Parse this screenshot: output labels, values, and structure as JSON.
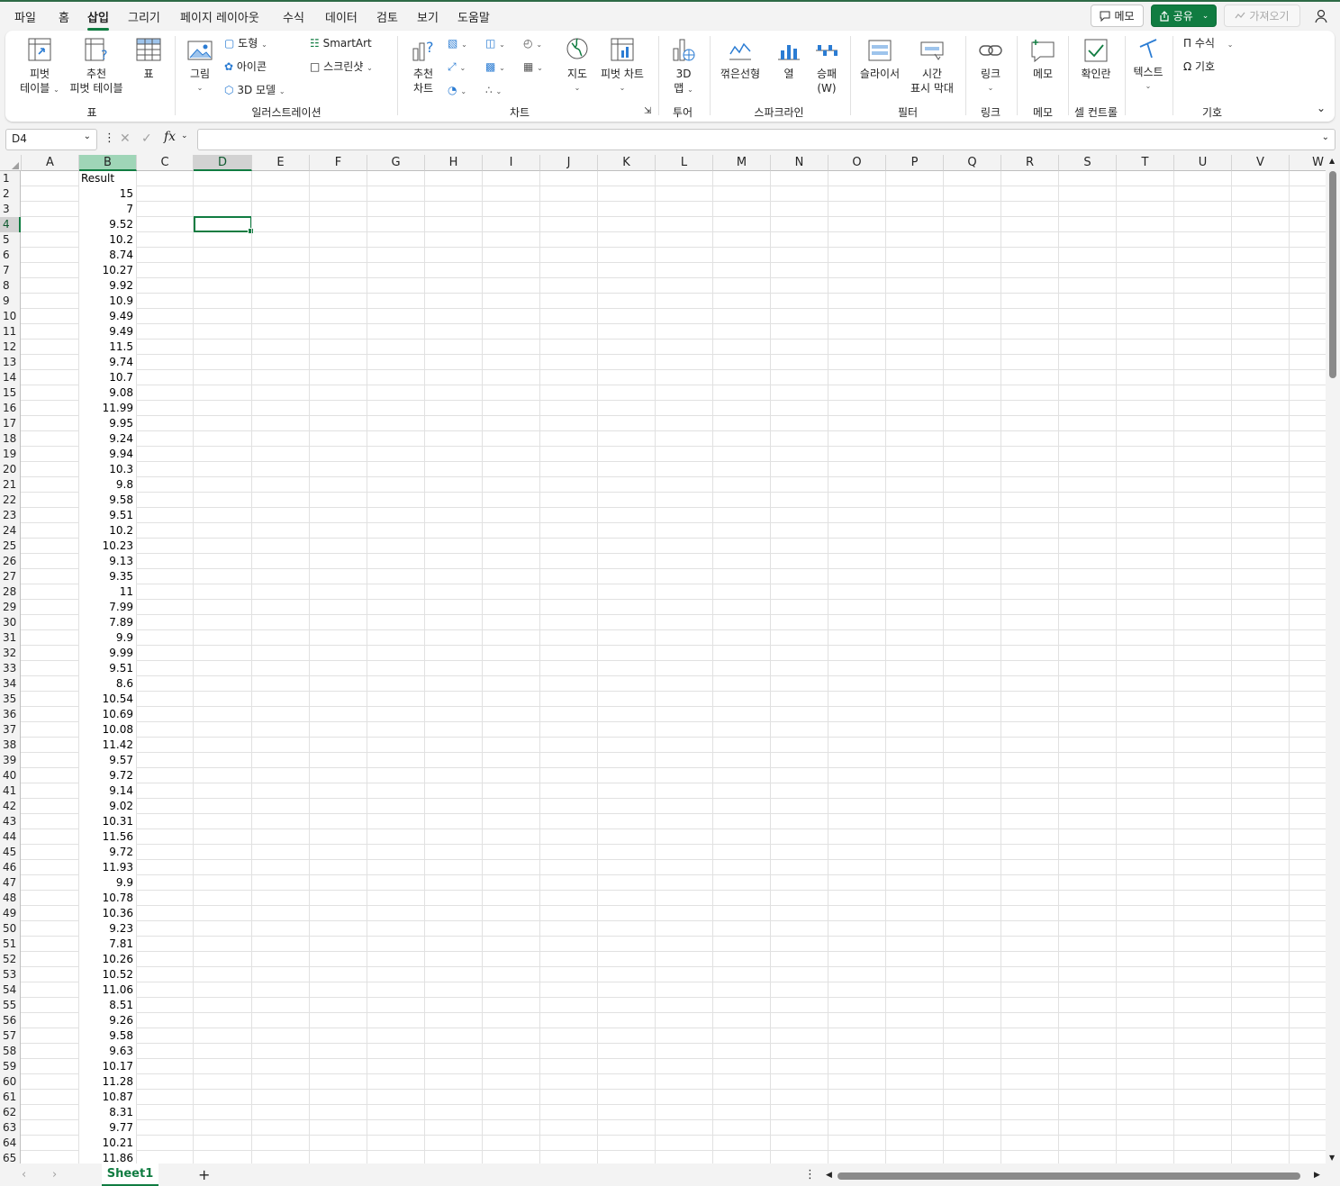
{
  "tabs": [
    "파일",
    "홈",
    "삽입",
    "그리기",
    "페이지 레이아웃",
    "수식",
    "데이터",
    "검토",
    "보기",
    "도움말"
  ],
  "active_tab": "삽입",
  "top_buttons": {
    "memo": "메모",
    "share": "공유",
    "fetch": "가져오기"
  },
  "ribbon": {
    "pivot_table": [
      "피벗",
      "테이블"
    ],
    "recommended_pivot": [
      "추천",
      "피벗 테이블"
    ],
    "table": "표",
    "picture": "그림",
    "shapes": "도형",
    "icons": "아이콘",
    "models3d": "3D 모델",
    "smartart": "SmartArt",
    "screenshot": "스크린샷",
    "recommended_charts": [
      "추천",
      "차트"
    ],
    "map": "지도",
    "pivot_chart": "피벗 차트",
    "map3d": [
      "3D",
      "맵"
    ],
    "spark_line": "꺾은선형",
    "spark_column": "열",
    "spark_winloss": [
      "승패",
      "(W)"
    ],
    "slicer": "슬라이서",
    "timeline": [
      "시간",
      "표시 막대"
    ],
    "link": "링크",
    "comment": "메모",
    "checkbox": "확인란",
    "text": "텍스트",
    "equation": "수식",
    "symbol": "기호",
    "groups": {
      "tables": "표",
      "illustrations": "일러스트레이션",
      "charts": "차트",
      "tours": "투어",
      "sparklines": "스파크라인",
      "filters": "필터",
      "links": "링크",
      "comments": "메모",
      "cell_controls": "셀 컨트롤",
      "symbols": "기호"
    }
  },
  "name_box": "D4",
  "formula_value": "",
  "columns": [
    "A",
    "B",
    "C",
    "D",
    "E",
    "F",
    "G",
    "H",
    "I",
    "J",
    "K",
    "L",
    "M",
    "N",
    "O",
    "P",
    "Q",
    "R",
    "S",
    "T",
    "U",
    "V",
    "W"
  ],
  "selected_column": "D",
  "highlighted_column": "B",
  "rows": [
    "1",
    "2",
    "3",
    "4",
    "5",
    "6",
    "7",
    "8",
    "9",
    "10",
    "11",
    "12",
    "13",
    "14",
    "15",
    "16",
    "17",
    "18",
    "19",
    "20",
    "21",
    "22",
    "23",
    "24",
    "25",
    "26",
    "27",
    "28",
    "29",
    "30",
    "31",
    "32",
    "33",
    "34",
    "35",
    "36",
    "37",
    "38",
    "39",
    "40",
    "41",
    "42",
    "43",
    "44",
    "45",
    "46",
    "47",
    "48",
    "49",
    "50",
    "51",
    "52",
    "53",
    "54",
    "55",
    "56",
    "57",
    "58",
    "59",
    "60",
    "61",
    "62",
    "63",
    "64",
    "65"
  ],
  "selected_row": "4",
  "column_b": [
    "Result",
    "15",
    "7",
    "9.52",
    "10.2",
    "8.74",
    "10.27",
    "9.92",
    "10.9",
    "9.49",
    "9.49",
    "11.5",
    "9.74",
    "10.7",
    "9.08",
    "11.99",
    "9.95",
    "9.24",
    "9.94",
    "10.3",
    "9.8",
    "9.58",
    "9.51",
    "10.2",
    "10.23",
    "9.13",
    "9.35",
    "11",
    "7.99",
    "7.89",
    "9.9",
    "9.99",
    "9.51",
    "8.6",
    "10.54",
    "10.69",
    "10.08",
    "11.42",
    "9.57",
    "9.72",
    "9.14",
    "9.02",
    "10.31",
    "11.56",
    "9.72",
    "11.93",
    "9.9",
    "10.78",
    "10.36",
    "9.23",
    "7.81",
    "10.26",
    "10.52",
    "11.06",
    "8.51",
    "9.26",
    "9.58",
    "9.63",
    "10.17",
    "11.28",
    "10.87",
    "8.31",
    "9.77",
    "10.21",
    "11.86"
  ],
  "sheet_tab": "Sheet1",
  "accent": "#107c41"
}
